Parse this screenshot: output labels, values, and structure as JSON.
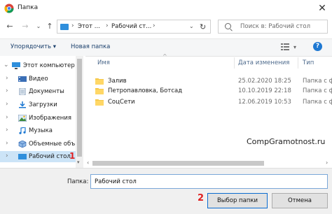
{
  "window": {
    "title": "Папка"
  },
  "address": {
    "crumb_1": "Этот ...",
    "crumb_2": "Рабочий ст..."
  },
  "search": {
    "placeholder": "Поиск в: Рабочий стол"
  },
  "toolbar": {
    "organize_label": "Упорядочить ▾",
    "new_folder_label": "Новая папка"
  },
  "sidebar": {
    "items": [
      {
        "label": "Этот компьютер",
        "icon": "computer-icon"
      },
      {
        "label": "Видео",
        "icon": "video-icon"
      },
      {
        "label": "Документы",
        "icon": "documents-icon"
      },
      {
        "label": "Загрузки",
        "icon": "downloads-icon"
      },
      {
        "label": "Изображения",
        "icon": "images-icon"
      },
      {
        "label": "Музыка",
        "icon": "music-icon"
      },
      {
        "label": "Объемные объ",
        "icon": "3d-objects-icon"
      },
      {
        "label": "Рабочий стол",
        "icon": "desktop-icon",
        "selected": true
      }
    ],
    "marker": "1"
  },
  "columns": {
    "name": "Имя",
    "date": "Дата изменения",
    "type": "Тип"
  },
  "files": [
    {
      "name": "Залив",
      "date": "25.02.2020 18:25",
      "type": "Папка с ф"
    },
    {
      "name": "Петропавловка, Ботсад",
      "date": "10.10.2019 22:18",
      "type": "Папка с ф"
    },
    {
      "name": "СоцСети",
      "date": "12.06.2019 10:53",
      "type": "Папка с ф"
    }
  ],
  "watermark": "CompGramotnost.ru",
  "footer": {
    "folder_label": "Папка:",
    "folder_value": "Рабочий стол",
    "select_label": "Выбор папки",
    "cancel_label": "Отмена",
    "marker": "2"
  },
  "colors": {
    "accent": "#0a6bd0",
    "selection": "#cce4f7",
    "folder": "#f5c84a",
    "marker": "#e02020"
  }
}
